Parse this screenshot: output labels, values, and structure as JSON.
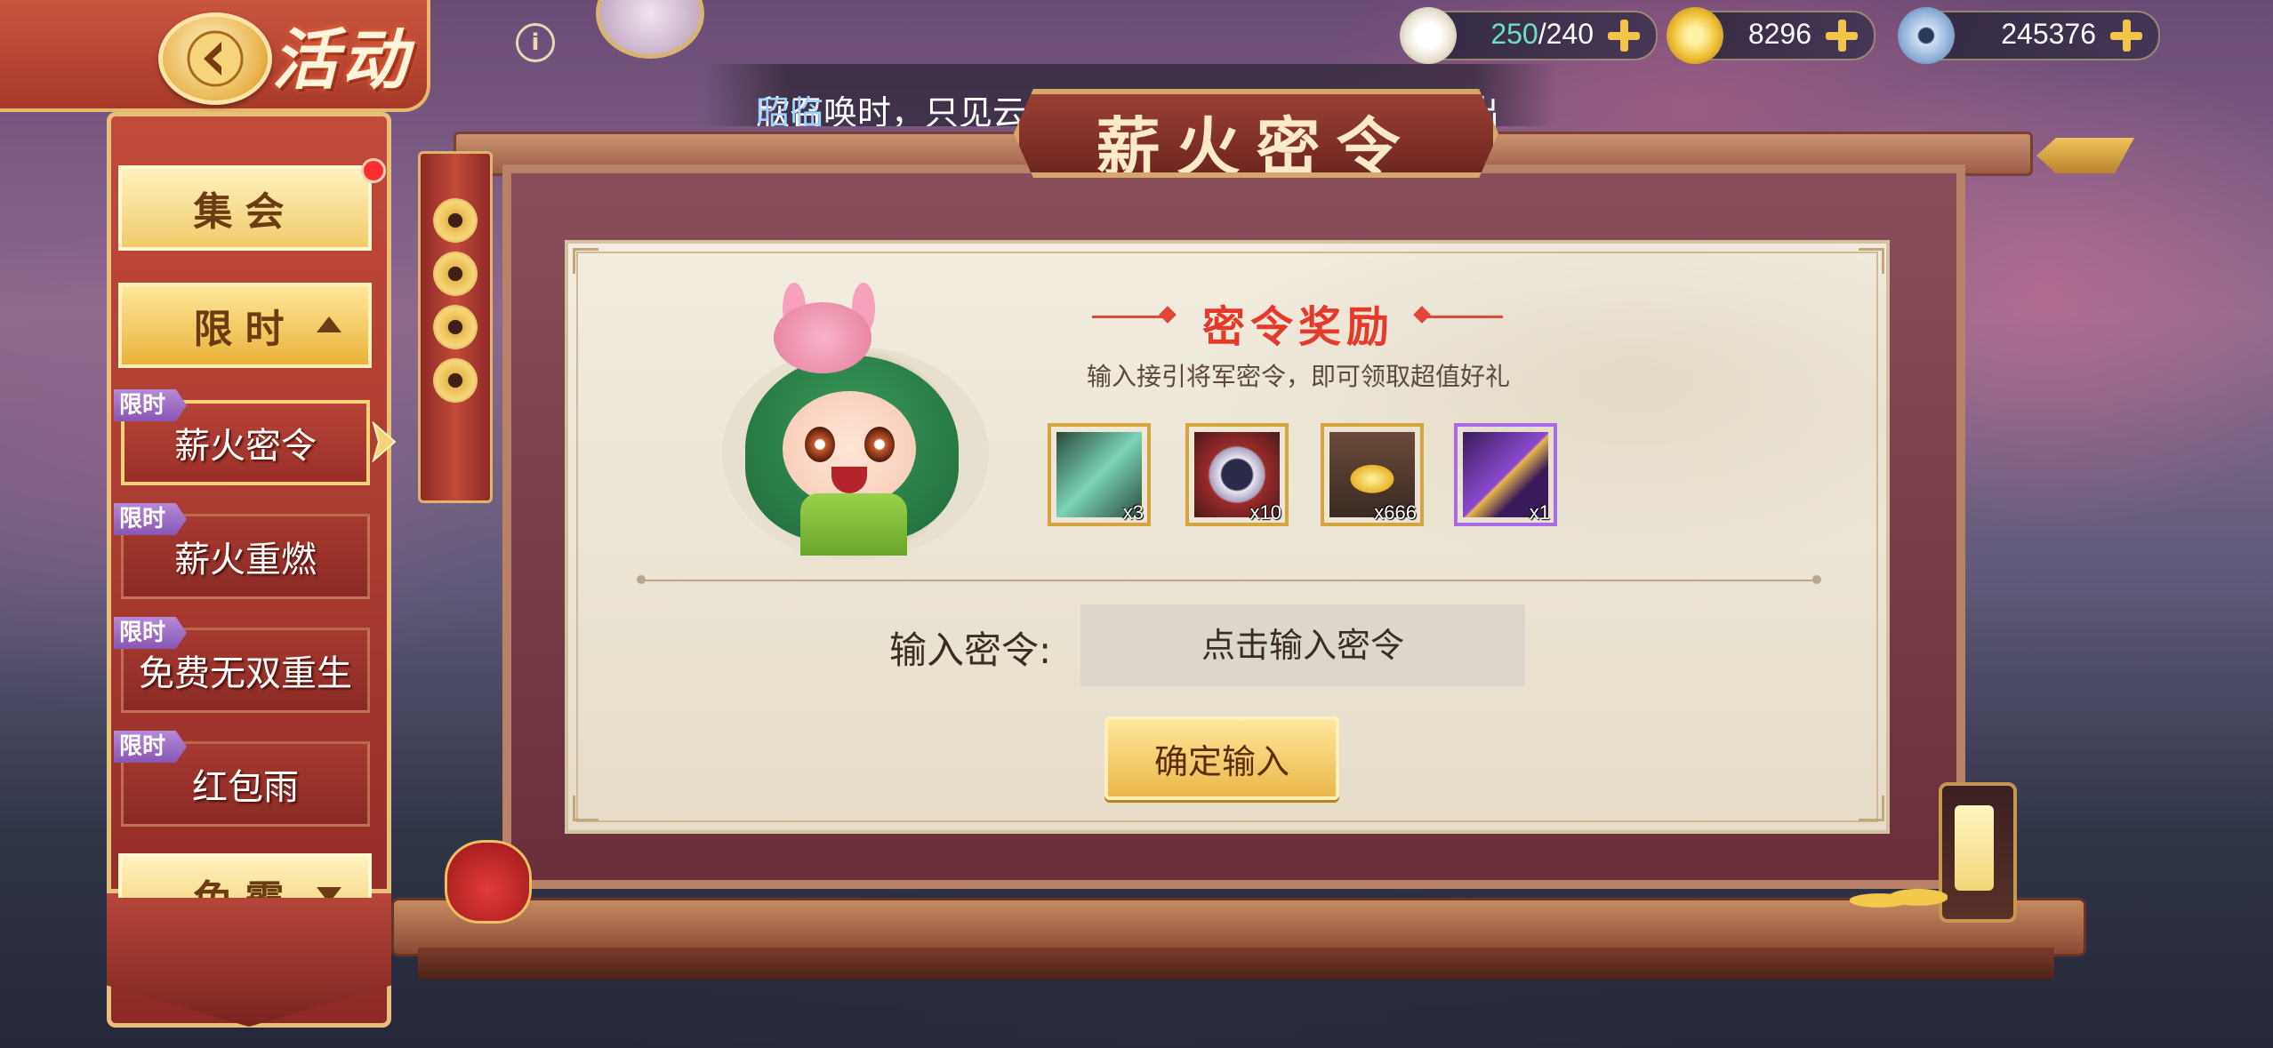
{
  "header": {
    "title": "活动",
    "stamina": {
      "current": "250",
      "max": "/240"
    },
    "gold": "8296",
    "coins": "245376"
  },
  "marquee": {
    "text_prefix": "欣召唤时，只见云层中一阵奇光闪过，成功召唤出",
    "text_highlight": "昭临"
  },
  "sidebar": {
    "categories": [
      {
        "label": "集会"
      },
      {
        "label": "限时"
      },
      {
        "label": "兔霸"
      }
    ],
    "tag_label": "限时",
    "items": [
      {
        "label": "薪火密令"
      },
      {
        "label": "薪火重燃"
      },
      {
        "label": "免费无双重生"
      },
      {
        "label": "红包雨"
      }
    ]
  },
  "panel": {
    "title": "薪火密令",
    "reward_title": "密令奖励",
    "reward_subtitle": "输入接引将军密令，即可领取超值好礼",
    "rewards": [
      {
        "icon": "jade-card-icon",
        "qty": "x3"
      },
      {
        "icon": "scroll-icon",
        "qty": "x10"
      },
      {
        "icon": "gold-ingot-icon",
        "qty": "x666"
      },
      {
        "icon": "avatar-frame-icon",
        "qty": "x1"
      }
    ],
    "code_label": "输入密令:",
    "code_placeholder": "点击输入密令",
    "confirm_label": "确定输入"
  }
}
